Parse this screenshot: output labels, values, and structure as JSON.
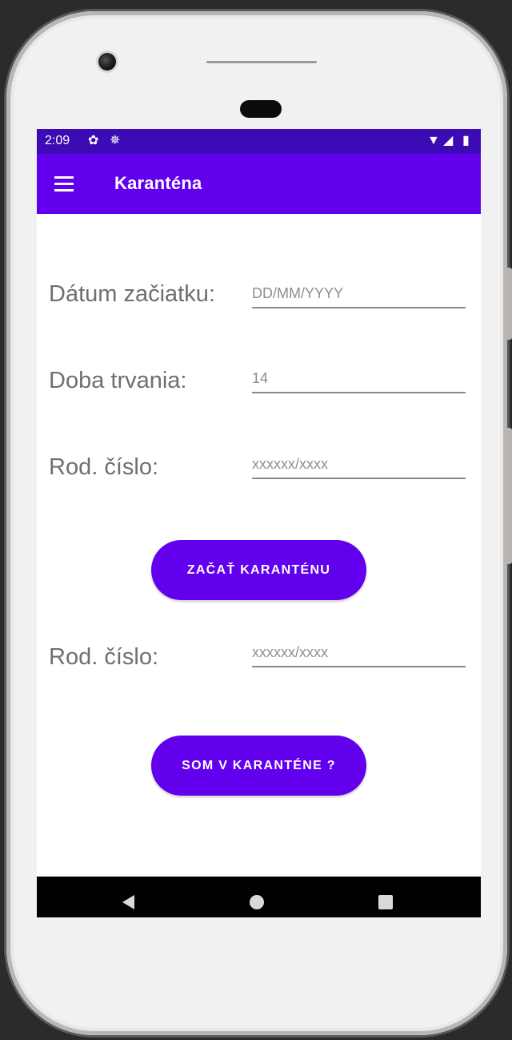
{
  "status_bar": {
    "time": "2:09",
    "icons_left": [
      "settings-icon",
      "bug-icon"
    ],
    "icons_right": [
      "wifi-icon",
      "signal-icon",
      "battery-icon"
    ],
    "color": "#3c0bb5"
  },
  "app_bar": {
    "title": "Karanténa",
    "color": "#6200ee"
  },
  "form": {
    "start_date": {
      "label": "Dátum začiatku:",
      "placeholder": "DD/MM/YYYY",
      "value": ""
    },
    "duration": {
      "label": "Doba trvania:",
      "placeholder": "",
      "value": "14"
    },
    "birth_number": {
      "label": "Rod. číslo:",
      "placeholder": "xxxxxx/xxxx",
      "value": ""
    },
    "start_button_label": "ZAČAŤ KARANTÉNU"
  },
  "check": {
    "birth_number": {
      "label": "Rod. číslo:",
      "placeholder": "xxxxxx/xxxx",
      "value": ""
    },
    "check_button_label": "SOM V KARANTÉNE ?"
  },
  "accent_color": "#6200ee"
}
